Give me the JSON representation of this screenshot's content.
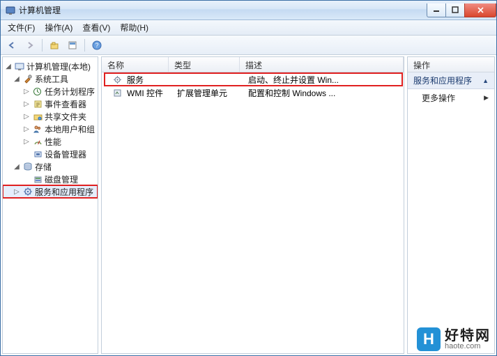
{
  "window": {
    "title": "计算机管理"
  },
  "menu": {
    "file": "文件(F)",
    "action": "操作(A)",
    "view": "查看(V)",
    "help": "帮助(H)"
  },
  "tree": {
    "root": "计算机管理(本地)",
    "system_tools": "系统工具",
    "task_scheduler": "任务计划程序",
    "event_viewer": "事件查看器",
    "shared_folders": "共享文件夹",
    "local_users": "本地用户和组",
    "performance": "性能",
    "device_mgr": "设备管理器",
    "storage": "存储",
    "disk_mgmt": "磁盘管理",
    "services_apps": "服务和应用程序"
  },
  "list": {
    "cols": {
      "name": "名称",
      "type": "类型",
      "desc": "描述"
    },
    "rows": [
      {
        "name": "服务",
        "type": "",
        "desc": "启动、终止并设置 Win..."
      },
      {
        "name": "WMI 控件",
        "type": "扩展管理单元",
        "desc": "配置和控制 Windows ..."
      }
    ]
  },
  "actions": {
    "header": "操作",
    "section": "服务和应用程序",
    "more": "更多操作"
  },
  "watermark": {
    "badge": "H",
    "cn": "好特网",
    "en": "haote.com"
  }
}
